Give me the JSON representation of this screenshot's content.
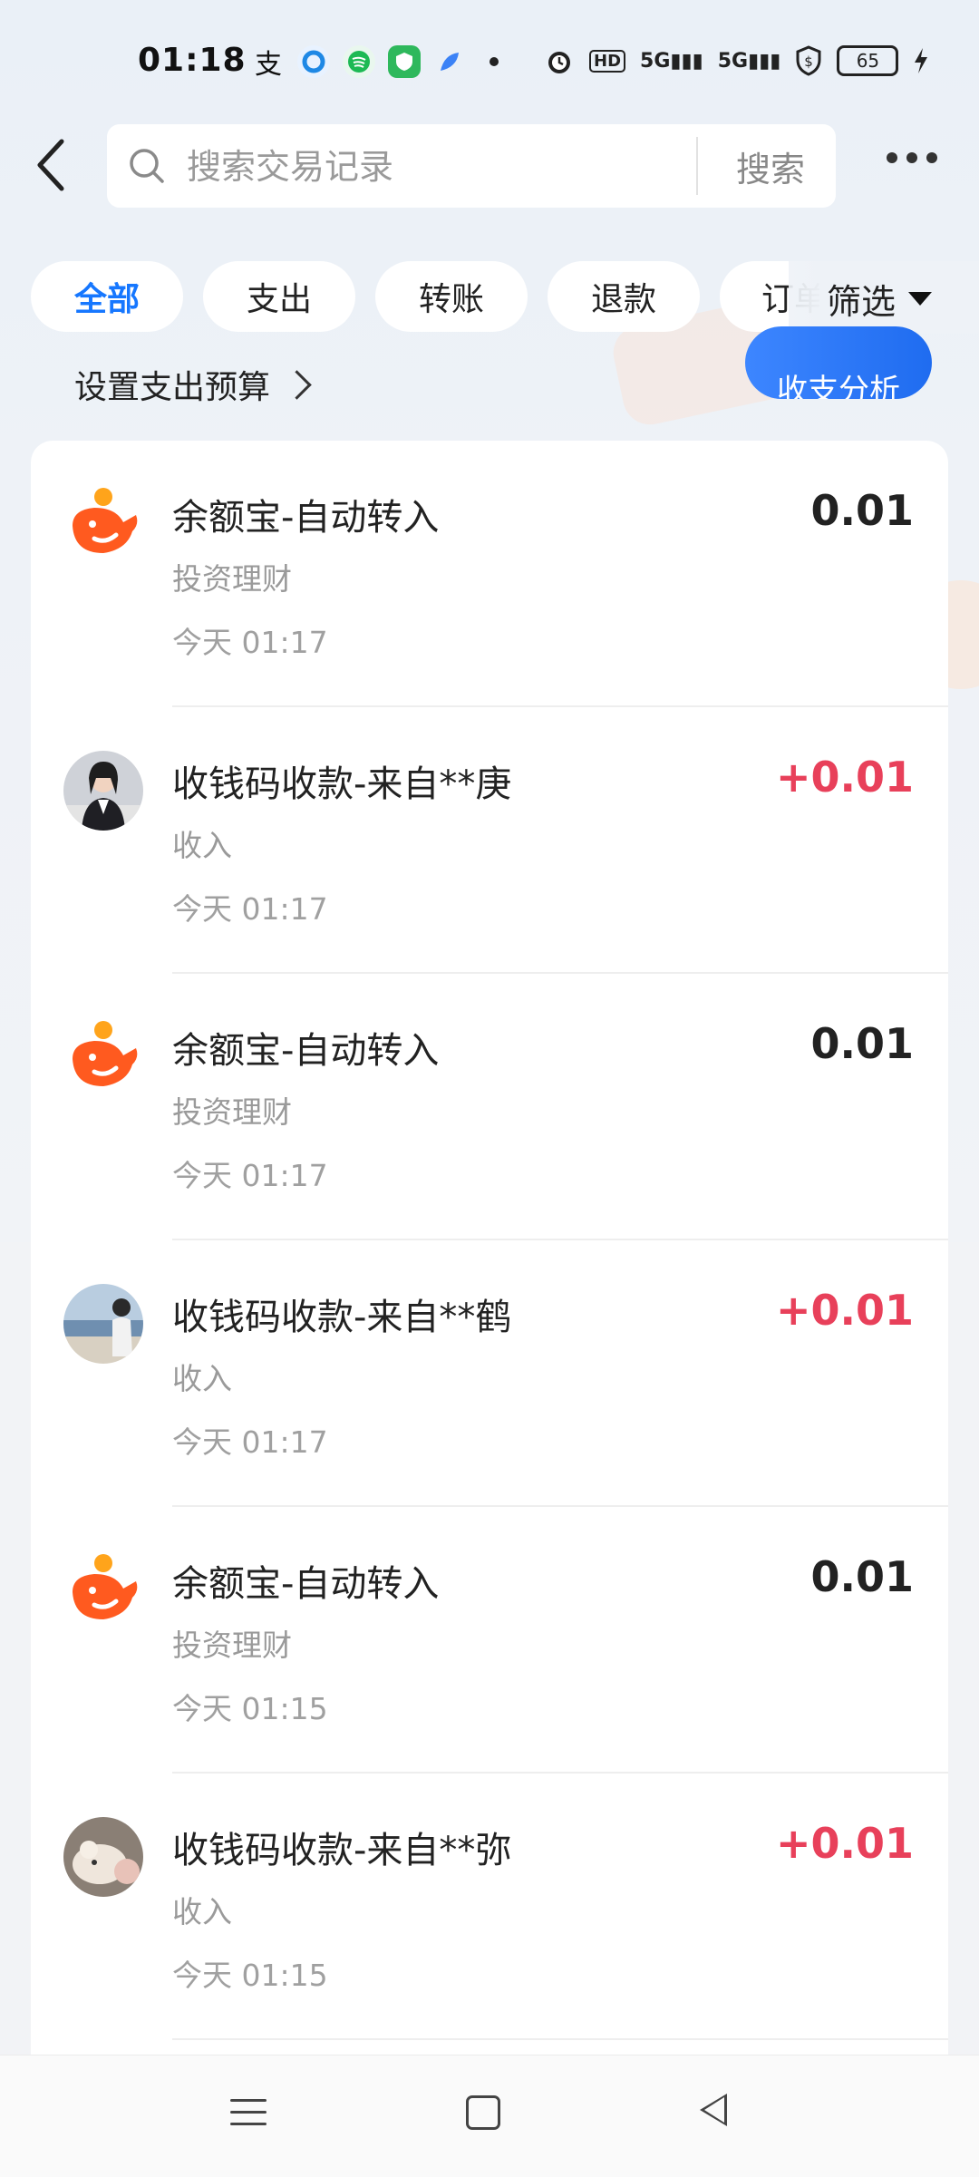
{
  "status_bar": {
    "time": "01:18",
    "network": "5G",
    "hd_label": "HD",
    "battery": "65"
  },
  "header": {
    "search_placeholder": "搜索交易记录",
    "search_button": "搜索"
  },
  "filters": {
    "chips": [
      "全部",
      "支出",
      "转账",
      "退款",
      "订单"
    ],
    "active_index": 0,
    "filter_button": "筛选"
  },
  "budget": {
    "label": "设置支出预算",
    "analysis_button": "收支分析"
  },
  "transactions": [
    {
      "title": "余额宝-自动转入",
      "category": "投资理财",
      "time": "今天 01:17",
      "amount": "0.01",
      "type": "yuebao"
    },
    {
      "title": "收钱码收款-来自**庚",
      "category": "收入",
      "time": "今天 01:17",
      "amount": "+0.01",
      "type": "income"
    },
    {
      "title": "余额宝-自动转入",
      "category": "投资理财",
      "time": "今天 01:17",
      "amount": "0.01",
      "type": "yuebao"
    },
    {
      "title": "收钱码收款-来自**鹤",
      "category": "收入",
      "time": "今天 01:17",
      "amount": "+0.01",
      "type": "income"
    },
    {
      "title": "余额宝-自动转入",
      "category": "投资理财",
      "time": "今天 01:15",
      "amount": "0.01",
      "type": "yuebao"
    },
    {
      "title": "收钱码收款-来自**弥",
      "category": "收入",
      "time": "今天 01:15",
      "amount": "+0.01",
      "type": "income"
    }
  ],
  "colors": {
    "accent": "#1677ff",
    "income": "#e8405a",
    "yuebao": "#ff5a1f"
  },
  "icons": {
    "back": "chevron-left-icon",
    "search": "search-icon",
    "more": "more-horizontal-icon",
    "filter": "triangle-down-icon"
  }
}
